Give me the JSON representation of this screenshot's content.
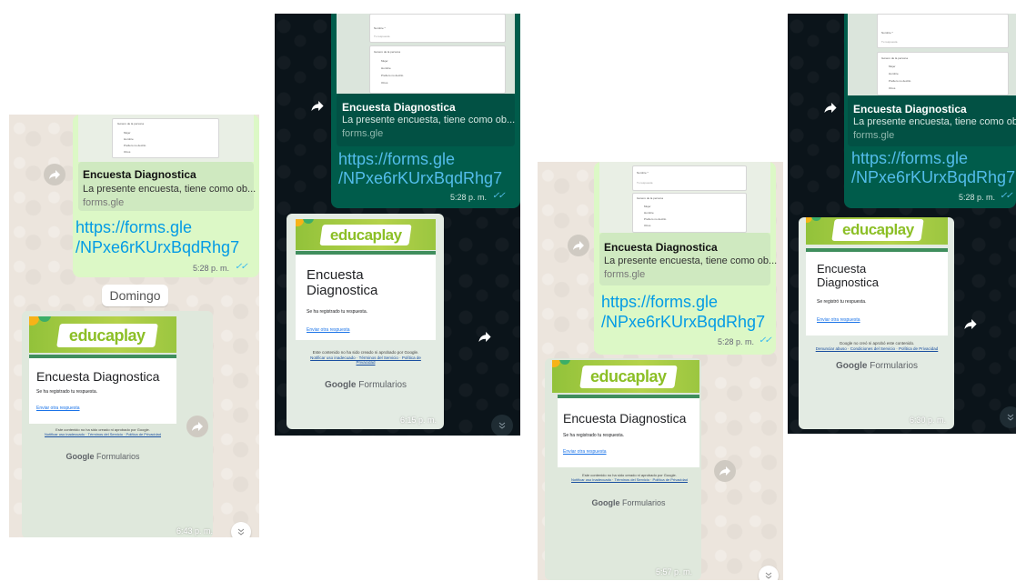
{
  "link_preview": {
    "title": "Encuesta Diagnostica",
    "description": "La presente encuesta, tiene como ob...",
    "domain": "forms.gle"
  },
  "link_text": {
    "line1": "https://forms.gle",
    "line2": "/NPxe6rKUrxBqdRhg7"
  },
  "sent_time": "5:28 p. m.",
  "ticks_glyph": "✓✓",
  "day_separator": "Domingo",
  "forward_icon": "forward-icon",
  "scroll_icon": "chevron-double-down-icon",
  "educaplay": {
    "logo": "educaplay"
  },
  "form_response": {
    "title": "Encuesta Diagnostica",
    "message_1": "Se ha registrado tu respuesta.",
    "message_2": "Se registró tu respuesta.",
    "another_link": "Enviar otra respuesta",
    "footer_1": "Este contenido no ha sido creado ni aprobado por Google.",
    "footer_1_links": "Notificar uso inadecuado · Términos del Servicio · Política de Privacidad",
    "footer_2": "Google no creó ni aprobó este contenido.",
    "footer_2_links": "Denunciar abuso · Condiciones del Servicio · Política de Privacidad",
    "google": "Google",
    "formularios": "Formularios"
  },
  "preview_form": {
    "field_label": "Nombre *",
    "field_placeholder": "Tu respuesta",
    "gender_label": "Género de la persona",
    "options": [
      "Mujer",
      "Hombre",
      "Prefiero no decirlo",
      "Otros"
    ]
  },
  "screens": [
    {
      "received_time": "6:43 p. m."
    },
    {
      "received_time": "6:15 p. m."
    },
    {
      "received_time": "5:57 p. m."
    },
    {
      "received_time": "6:30 p. m."
    }
  ],
  "colors": {
    "light_bg": "#ece5dd",
    "dark_bg": "#0b141a",
    "light_bubble": "#dcf8c6",
    "dark_bubble": "#005c4b",
    "link_light": "#039be5",
    "link_dark": "#53bdeb",
    "educaplay_green": "#8cbf26"
  }
}
